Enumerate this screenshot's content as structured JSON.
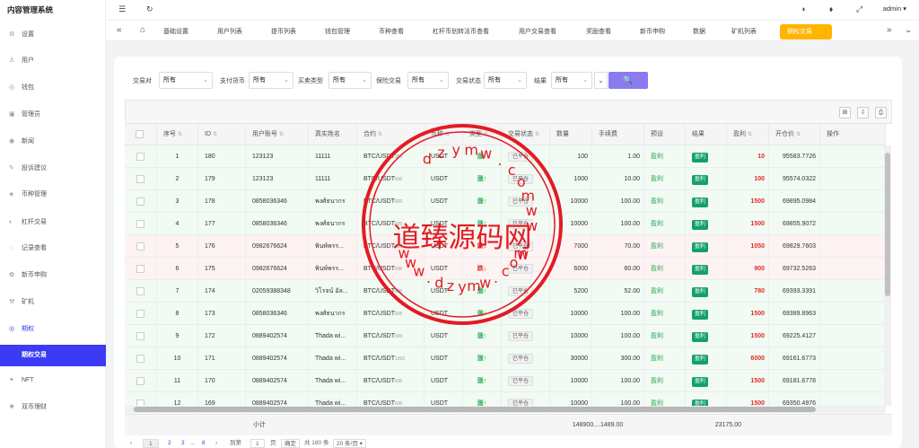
{
  "app": {
    "title": "内容管理系统",
    "user": "admin"
  },
  "sidebar": {
    "items": [
      {
        "label": "设置",
        "icon": "gear-icon",
        "glyph": "⚙"
      },
      {
        "label": "用户",
        "icon": "user-icon",
        "glyph": "♙"
      },
      {
        "label": "钱包",
        "icon": "wallet-icon",
        "glyph": "◎"
      },
      {
        "label": "管理员",
        "icon": "admin-icon",
        "glyph": "▣"
      },
      {
        "label": "新闻",
        "icon": "news-icon",
        "glyph": "◉"
      },
      {
        "label": "投诉建议",
        "icon": "feedback-icon",
        "glyph": "✎"
      },
      {
        "label": "币种管理",
        "icon": "coin-icon",
        "glyph": "◈"
      },
      {
        "label": "杠杆交易",
        "icon": "lever-icon",
        "glyph": "◐"
      },
      {
        "label": "记录查看",
        "icon": "record-icon",
        "glyph": "◌"
      },
      {
        "label": "新币申购",
        "icon": "newcoin-icon",
        "glyph": "✿"
      },
      {
        "label": "矿机",
        "icon": "miner-icon",
        "glyph": "⚒"
      },
      {
        "label": "期权",
        "icon": "option-icon",
        "glyph": "◎"
      },
      {
        "label": "期权交易",
        "icon": "",
        "glyph": ""
      },
      {
        "label": "NFT",
        "icon": "nft-icon",
        "glyph": "✦"
      },
      {
        "label": "双币理财",
        "icon": "finance-icon",
        "glyph": "❖"
      }
    ]
  },
  "tabs": [
    "基础设置",
    "用户列表",
    "提币列表",
    "钱包管理",
    "币种查看",
    "杠杆币划转法币查看",
    "用户交易查看",
    "奖励查看",
    "新币申购",
    "数据",
    "矿机列表",
    "期权交易"
  ],
  "filters": [
    {
      "label": "交易对",
      "value": "所有"
    },
    {
      "label": "支付货币",
      "value": "所有"
    },
    {
      "label": "买卖类型",
      "value": "所有"
    },
    {
      "label": "保险交易",
      "value": "所有"
    },
    {
      "label": "交易状态",
      "value": "所有"
    },
    {
      "label": "结果",
      "value": "所有"
    }
  ],
  "search_icon": "🔍",
  "table": {
    "headers": [
      "序号",
      "ID",
      "用户账号",
      "真实姓名",
      "合约",
      "币种",
      "类型",
      "交易状态",
      "数量",
      "手续费",
      "预设",
      "结果",
      "盈利",
      "开仓价",
      "操作"
    ],
    "rows": [
      {
        "seq": "1",
        "id": "180",
        "account": "123123",
        "name": "11111",
        "contract": "BTC/USDT",
        "csub": "300",
        "coin": "USDT",
        "type": "涨↑",
        "dir": "up",
        "status": "已平仓",
        "qty": "100",
        "fee": "1.00",
        "preset": "盈利",
        "result": "盈利",
        "profit": "10",
        "open": "95583.7726"
      },
      {
        "seq": "2",
        "id": "179",
        "account": "123123",
        "name": "11111",
        "contract": "BTC/USDT",
        "csub": "600",
        "coin": "USDT",
        "type": "涨↑",
        "dir": "up",
        "status": "已平仓",
        "qty": "1000",
        "fee": "10.00",
        "preset": "盈利",
        "result": "盈利",
        "profit": "100",
        "open": "95574.0322"
      },
      {
        "seq": "3",
        "id": "178",
        "account": "0858036346",
        "name": "พงศ์ธนากร",
        "contract": "BTC/USDT",
        "csub": "600",
        "coin": "USDT",
        "type": "涨↑",
        "dir": "up",
        "status": "已平仓",
        "qty": "10000",
        "fee": "100.00",
        "preset": "盈利",
        "result": "盈利",
        "profit": "1500",
        "open": "69895.0984"
      },
      {
        "seq": "4",
        "id": "177",
        "account": "0858036346",
        "name": "พงศ์ธนากร",
        "contract": "BTC/USDT",
        "csub": "600",
        "coin": "USDT",
        "type": "涨↑",
        "dir": "up",
        "status": "已平仓",
        "qty": "10000",
        "fee": "100.00",
        "preset": "盈利",
        "result": "盈利",
        "profit": "1500",
        "open": "69855.9072"
      },
      {
        "seq": "5",
        "id": "176",
        "account": "0982676624",
        "name": "พินพ์พรร...",
        "contract": "BTC/USDT",
        "csub": "600",
        "coin": "USDT",
        "type": "跌↓",
        "dir": "down",
        "status": "已平仓",
        "qty": "7000",
        "fee": "70.00",
        "preset": "盈利",
        "result": "盈利",
        "profit": "1050",
        "open": "69829.7603"
      },
      {
        "seq": "6",
        "id": "175",
        "account": "0982676624",
        "name": "พินพ์พรร...",
        "contract": "BTC/USDT",
        "csub": "600",
        "coin": "USDT",
        "type": "跌↓",
        "dir": "down",
        "status": "已平仓",
        "qty": "6000",
        "fee": "60.00",
        "preset": "盈利",
        "result": "盈利",
        "profit": "900",
        "open": "69732.5263"
      },
      {
        "seq": "7",
        "id": "174",
        "account": "02059388348",
        "name": "วิโรจน์ อัล...",
        "contract": "BTC/USDT",
        "csub": "600",
        "coin": "USDT",
        "type": "涨↑",
        "dir": "up",
        "status": "已平仓",
        "qty": "5200",
        "fee": "52.00",
        "preset": "盈利",
        "result": "盈利",
        "profit": "780",
        "open": "69393.3391"
      },
      {
        "seq": "8",
        "id": "173",
        "account": "0858036346",
        "name": "พงศ์ธนากร",
        "contract": "BTC/USDT",
        "csub": "600",
        "coin": "USDT",
        "type": "涨↑",
        "dir": "up",
        "status": "已平仓",
        "qty": "10000",
        "fee": "100.00",
        "preset": "盈利",
        "result": "盈利",
        "profit": "1500",
        "open": "69389.8963"
      },
      {
        "seq": "9",
        "id": "172",
        "account": "0889402574",
        "name": "Thada wi...",
        "contract": "BTC/USDT",
        "csub": "600",
        "coin": "USDT",
        "type": "涨↑",
        "dir": "up",
        "status": "已平仓",
        "qty": "10000",
        "fee": "100.00",
        "preset": "盈利",
        "result": "盈利",
        "profit": "1500",
        "open": "69225.4127"
      },
      {
        "seq": "10",
        "id": "171",
        "account": "0889402574",
        "name": "Thada wi...",
        "contract": "BTC/USDT",
        "csub": "1200",
        "coin": "USDT",
        "type": "涨↑",
        "dir": "up",
        "status": "已平仓",
        "qty": "30000",
        "fee": "300.00",
        "preset": "盈利",
        "result": "盈利",
        "profit": "6000",
        "open": "69161.6773"
      },
      {
        "seq": "11",
        "id": "170",
        "account": "0889402574",
        "name": "Thada wi...",
        "contract": "BTC/USDT",
        "csub": "600",
        "coin": "USDT",
        "type": "涨↑",
        "dir": "up",
        "status": "已平仓",
        "qty": "10000",
        "fee": "100.00",
        "preset": "盈利",
        "result": "盈利",
        "profit": "1500",
        "open": "69181.6778"
      },
      {
        "seq": "12",
        "id": "169",
        "account": "0889402574",
        "name": "Thada wi...",
        "contract": "BTC/USDT",
        "csub": "600",
        "coin": "USDT",
        "type": "涨↑",
        "dir": "up",
        "status": "已平仓",
        "qty": "10000",
        "fee": "100.00",
        "preset": "盈利",
        "result": "盈利",
        "profit": "1500",
        "open": "69350.4976"
      }
    ],
    "footer": {
      "label": "小计",
      "qty": "148900....",
      "fee": "1489.00",
      "profit": "23175.00"
    }
  },
  "pager": {
    "pages": [
      "1",
      "2",
      "3",
      "...",
      "8"
    ],
    "goto_label": "到第",
    "goto_value": "1",
    "page_unit": "页",
    "confirm": "确定",
    "total": "共 180 条",
    "page_size": "20 条/页"
  },
  "watermark": {
    "text": "道臻源码网",
    "letters_top": [
      "d",
      "z",
      "y",
      "m",
      "w",
      ".",
      "c",
      "o",
      "m",
      "w",
      "w",
      ".",
      "w"
    ],
    "letters_bottom": [
      "w",
      "w",
      "w",
      ".",
      "d",
      "z",
      "y",
      "m",
      "w",
      ".",
      "c",
      "o",
      "m"
    ],
    "color": "#e31b23"
  },
  "colors": {
    "accent": "#3b3bf5",
    "tab_active": "#ffb400",
    "up": "#1fa64a",
    "down": "#e52b2b"
  }
}
